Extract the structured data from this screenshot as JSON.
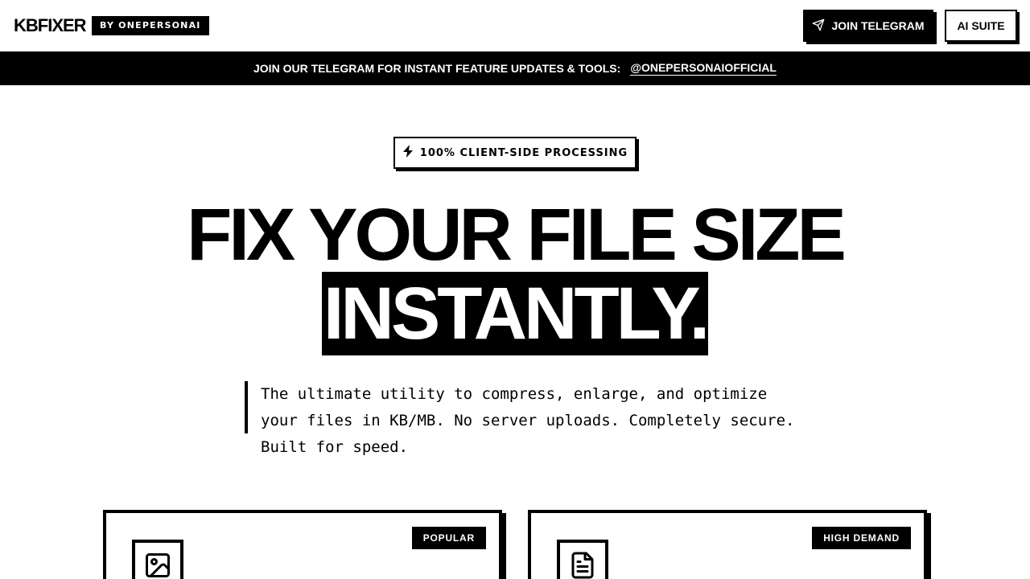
{
  "header": {
    "logo": "KBFIXER",
    "by_badge": "BY ONEPERSONAI",
    "telegram_button": "JOIN TELEGRAM",
    "suite_button": "AI SUITE"
  },
  "announcement": {
    "text": "JOIN OUR TELEGRAM FOR INSTANT FEATURE UPDATES & TOOLS:",
    "link": "@ONEPERSONAIOFFICIAL"
  },
  "hero": {
    "pill": "100% CLIENT-SIDE PROCESSING",
    "headline_line1": "FIX YOUR FILE SIZE",
    "headline_line2": "INSTANTLY.",
    "description": "The ultimate utility to compress, enlarge, and optimize your files in KB/MB. No server uploads. Completely secure. Built for speed."
  },
  "cards": [
    {
      "badge": "POPULAR",
      "icon": "image-icon"
    },
    {
      "badge": "HIGH DEMAND",
      "icon": "document-icon"
    }
  ],
  "colors": {
    "primary": "#000000",
    "background": "#ffffff"
  }
}
